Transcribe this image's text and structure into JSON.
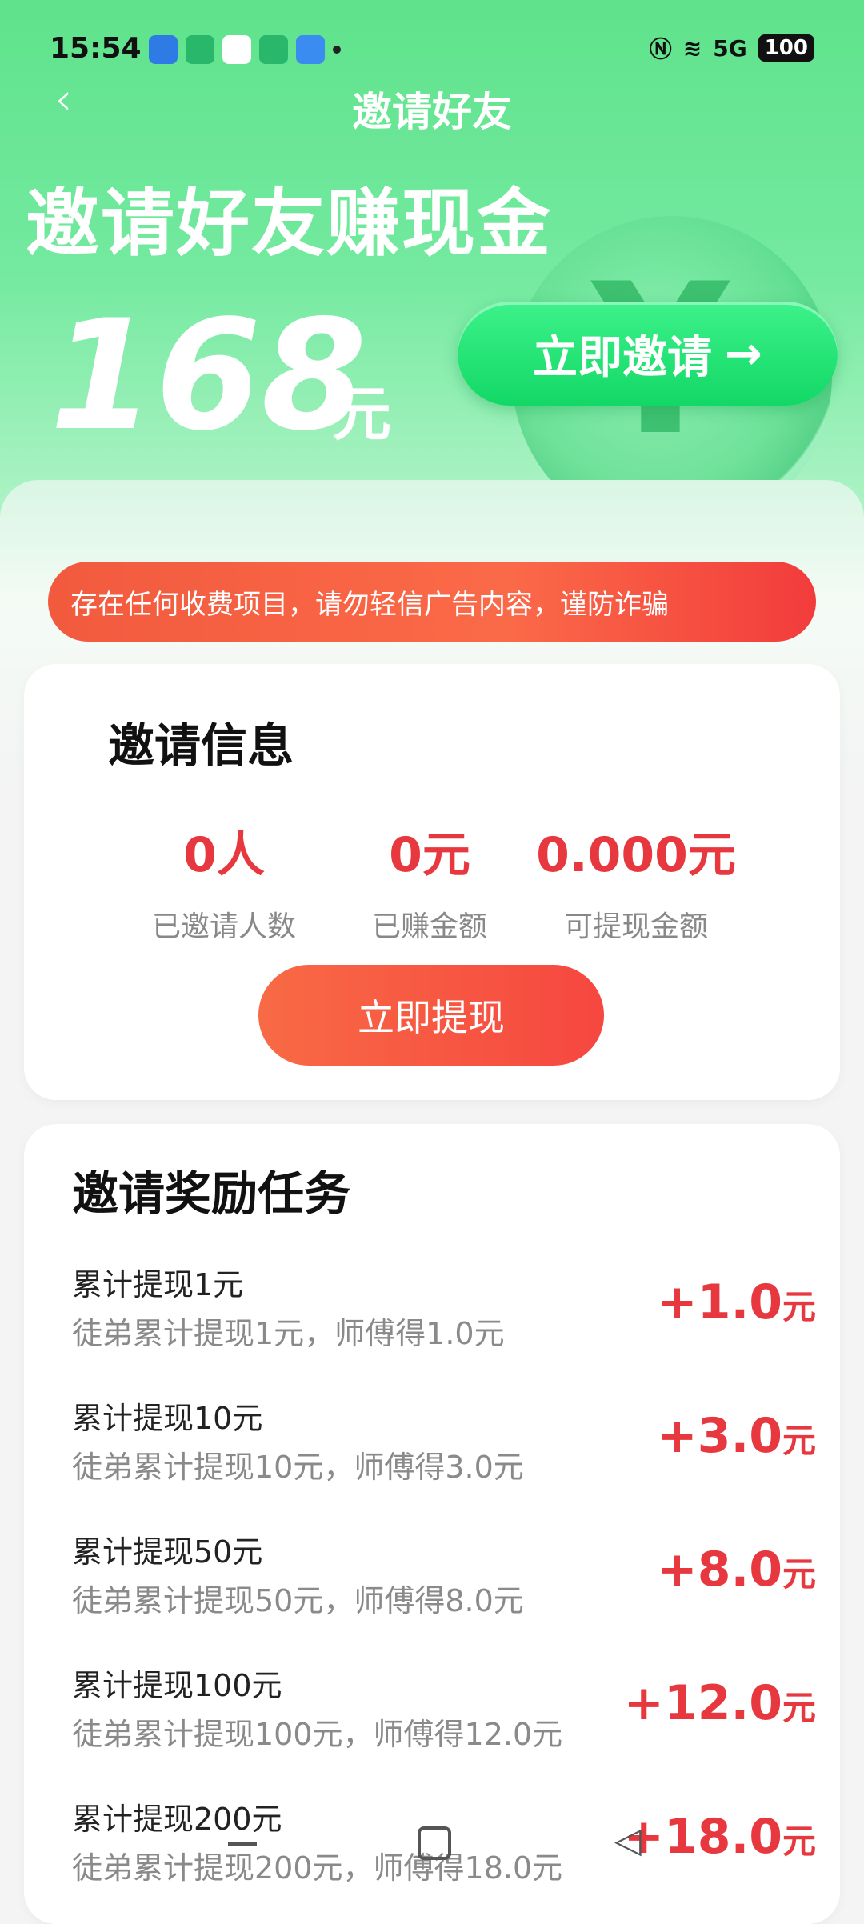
{
  "status_bar": {
    "time": "15:54",
    "network": "5G",
    "battery": "100"
  },
  "nav": {
    "back_icon": "chevron-left-icon",
    "title": "邀请好友"
  },
  "hero": {
    "headline": "邀请好友赚现金",
    "amount": "168",
    "unit": "元",
    "invite_button": "立即邀请",
    "invite_arrow": "→"
  },
  "notice": {
    "text": "存在任何收费项目，请勿轻信广告内容，谨防诈骗"
  },
  "invite_info": {
    "title": "邀请信息",
    "stats": [
      {
        "value": "0人",
        "label": "已邀请人数"
      },
      {
        "value": "0元",
        "label": "已赚金额"
      },
      {
        "value": "0.000元",
        "label": "可提现金额"
      }
    ],
    "withdraw_button": "立即提现"
  },
  "reward_tasks": {
    "title": "邀请奖励任务",
    "items": [
      {
        "title": "累计提现1元",
        "desc": "徒弟累计提现1元，师傅得1.0元",
        "reward": "+1.0",
        "unit": "元"
      },
      {
        "title": "累计提现10元",
        "desc": "徒弟累计提现10元，师傅得3.0元",
        "reward": "+3.0",
        "unit": "元"
      },
      {
        "title": "累计提现50元",
        "desc": "徒弟累计提现50元，师傅得8.0元",
        "reward": "+8.0",
        "unit": "元"
      },
      {
        "title": "累计提现100元",
        "desc": "徒弟累计提现100元，师傅得12.0元",
        "reward": "+12.0",
        "unit": "元"
      },
      {
        "title": "累计提现200元",
        "desc": "徒弟累计提现200元，师傅得18.0元",
        "reward": "+18.0",
        "unit": "元"
      }
    ]
  },
  "colors": {
    "brand_green": "#12d866",
    "accent_red": "#e8383f",
    "notice_red": "#f25a3e"
  }
}
